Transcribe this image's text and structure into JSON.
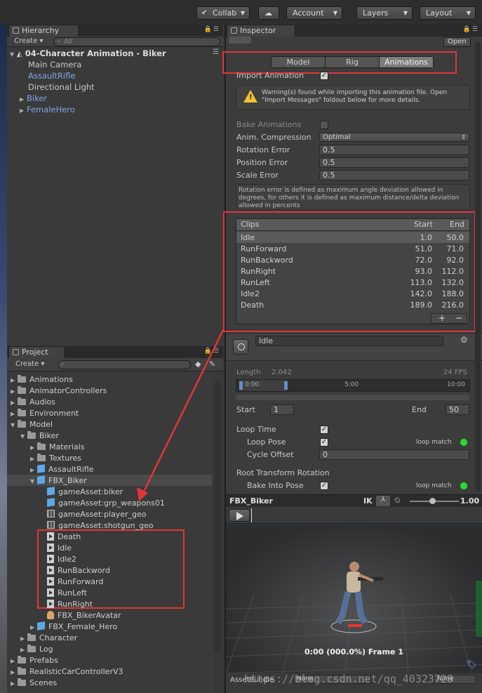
{
  "toolbar": {
    "collab": "Collab",
    "account": "Account",
    "layers": "Layers",
    "layout": "Layout"
  },
  "hierarchy": {
    "tab": "Hierarchy",
    "create": "Create",
    "search_placeholder": "All",
    "scene": "04-Character Animation - Biker",
    "items": [
      "Main Camera",
      "AssaultRifle",
      "Directional Light",
      "Biker",
      "FemaleHero"
    ]
  },
  "project": {
    "tab": "Project",
    "create": "Create",
    "items": [
      "Animations",
      "AnimatorControllers",
      "Audios",
      "Environment",
      "Model",
      "Biker",
      "Materials",
      "Textures",
      "AssaultRifle",
      "FBX_Biker",
      "gameAsset:biker",
      "gameAsset:grp_weapons01",
      "gameAsset:player_geo",
      "gameAsset:shotgun_geo",
      "Death",
      "Idle",
      "Idle2",
      "RunBackword",
      "RunForward",
      "RunLeft",
      "RunRight",
      "FBX_BikerAvatar",
      "FBX_Female_Hero",
      "Character",
      "Log",
      "Prefabs",
      "RealisticCarControllerV3",
      "Scenes"
    ]
  },
  "inspector": {
    "tab": "Inspector",
    "open_button": "Open",
    "tabs": [
      "Model",
      "Rig",
      "Animations"
    ],
    "active_tab": "Animations",
    "import_animation": "Import Animation",
    "warning": "Warning(s) found while importing this animation file. Open \"Import Messages\" foldout below for more details.",
    "bake_animations": "Bake Animations",
    "anim_compression_label": "Anim. Compression",
    "anim_compression_value": "Optimal",
    "rotation_error_label": "Rotation Error",
    "rotation_error_value": "0.5",
    "position_error_label": "Position Error",
    "position_error_value": "0.5",
    "scale_error_label": "Scale Error",
    "scale_error_value": "0.5",
    "error_hint": "Rotation error is defined as maximum angle deviation allowed in degrees, for others it is defined as maximum distance/delta deviation allowed in percents",
    "clips_header": {
      "name": "Clips",
      "start": "Start",
      "end": "End"
    },
    "clips": [
      {
        "name": "Idle",
        "start": "1.0",
        "end": "50.0"
      },
      {
        "name": "RunForward",
        "start": "51.0",
        "end": "71.0"
      },
      {
        "name": "RunBackword",
        "start": "72.0",
        "end": "92.0"
      },
      {
        "name": "RunRight",
        "start": "93.0",
        "end": "112.0"
      },
      {
        "name": "RunLeft",
        "start": "113.0",
        "end": "132.0"
      },
      {
        "name": "Idle2",
        "start": "142.0",
        "end": "188.0"
      },
      {
        "name": "Death",
        "start": "189.0",
        "end": "216.0"
      }
    ],
    "add_btn": "+",
    "remove_btn": "−",
    "clip_name": "Idle",
    "length_label": "Length",
    "length_value": "2.042",
    "fps": "24 FPS",
    "timeline_marks": [
      "0:00",
      "5:00",
      "10:00"
    ],
    "start_label": "Start",
    "start_value": "1",
    "end_label": "End",
    "end_value": "50",
    "loop_time": "Loop Time",
    "loop_pose": "Loop Pose",
    "loop_match": "loop match",
    "cycle_offset_label": "Cycle Offset",
    "cycle_offset_value": "0",
    "root_transform_rotation": "Root Transform Rotation",
    "bake_into_pose": "Bake Into Pose"
  },
  "preview": {
    "title": "FBX_Biker",
    "ik": "IK",
    "speed": "1.00",
    "frame_readout": "0:00 (000.0%) Frame 1",
    "assetbundle_label": "AssetBundle",
    "assetbundle_value": "None",
    "variant_value": "None",
    "watermark": "https://blog.csdn.net/qq_40323728"
  },
  "colors": {
    "highlight": "#e2353a",
    "accent_blue": "#7fa7e8",
    "loop_match": "#39d239"
  }
}
